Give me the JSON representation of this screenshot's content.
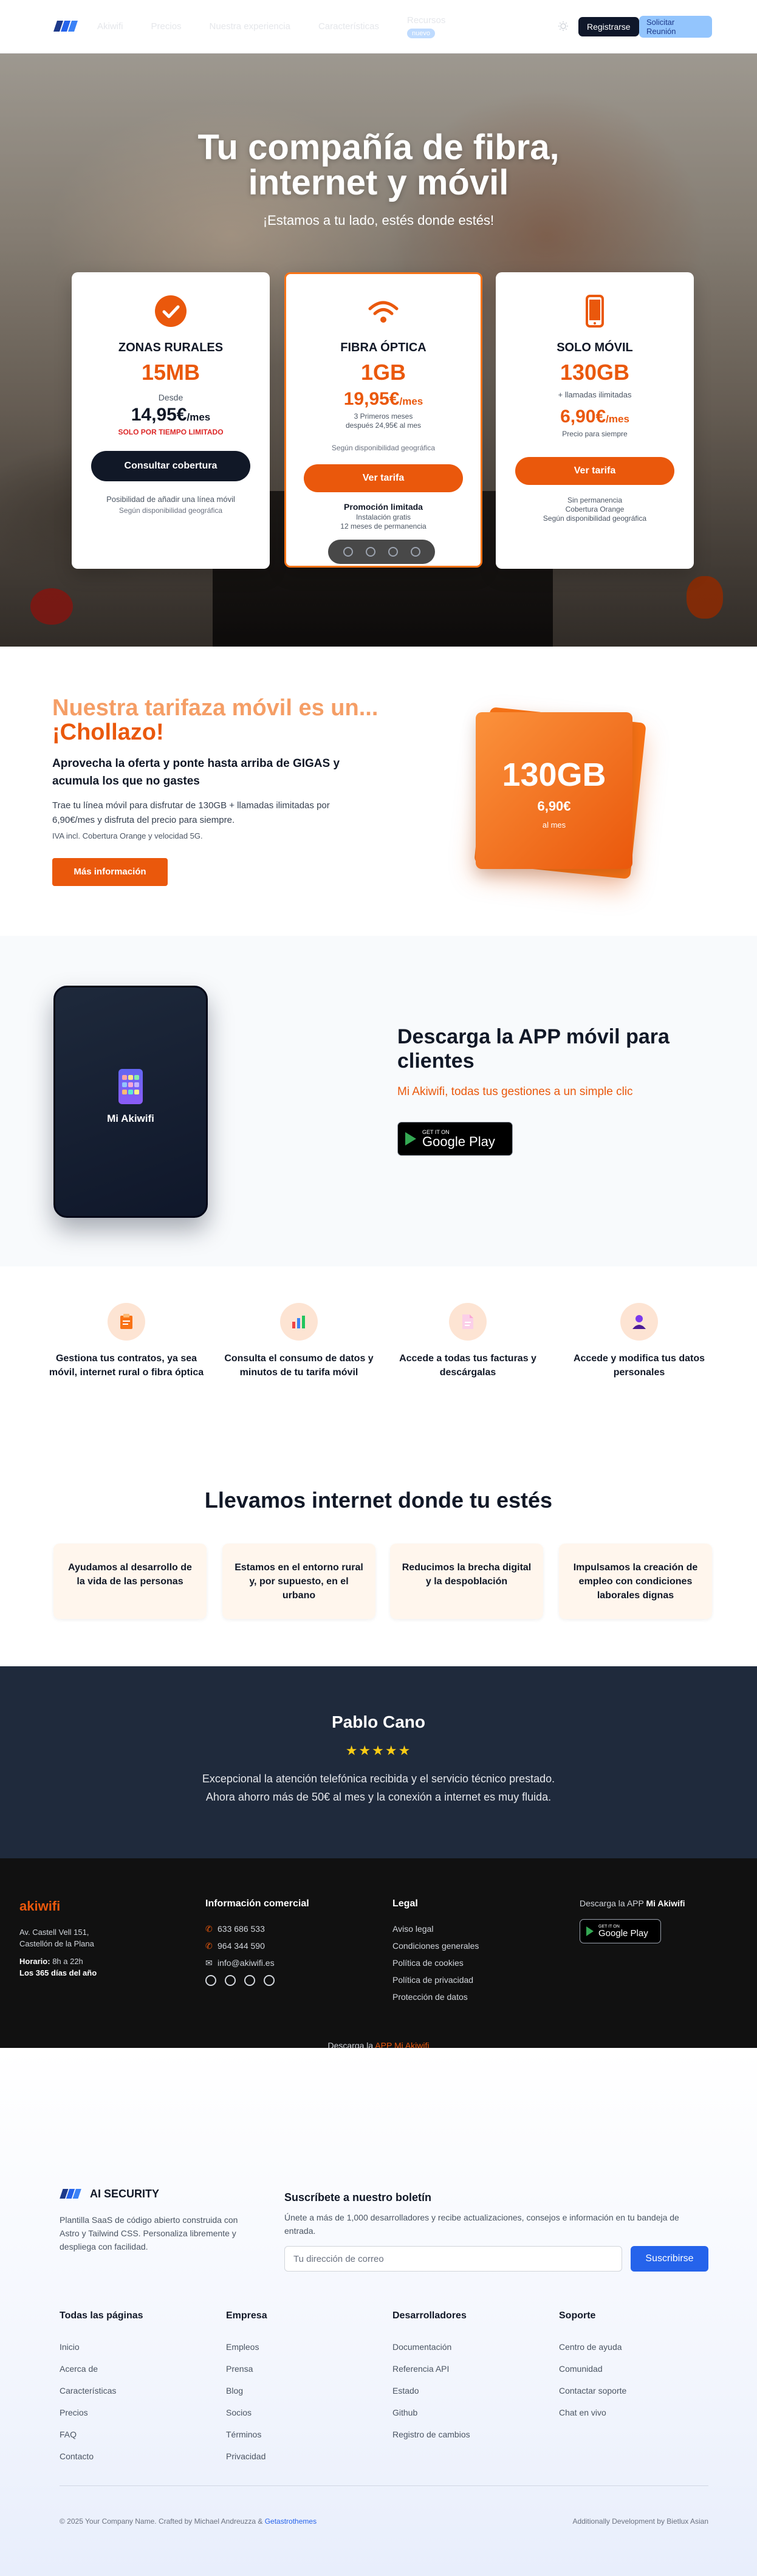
{
  "nav": {
    "links": [
      "Akiwifi",
      "Precios",
      "Nuestra experiencia",
      "Características",
      "Recursos"
    ],
    "new_badge": "nuevo",
    "register": "Registrarse",
    "meeting": "Solicitar Reunión"
  },
  "hero": {
    "title_l1": "Tu compañía de fibra,",
    "title_l2": "internet y móvil",
    "subtitle": "¡Estamos a tu lado, estés donde estés!"
  },
  "plans": [
    {
      "name": "ZONAS RURALES",
      "data": "15MB",
      "line1": "Desde",
      "price": "14,95€",
      "price_unit": "/mes",
      "flag": "SOLO POR TIEMPO LIMITADO",
      "button": "Consultar cobertura",
      "note": "Posibilidad de añadir una línea móvil",
      "note2": "Según disponibilidad geográfica"
    },
    {
      "name": "FIBRA ÓPTICA",
      "data": "1GB",
      "price": "19,95€",
      "price_unit": "/mes",
      "small1": "3 Primeros meses",
      "small2": "después 24,95€ al mes",
      "note2": "Según disponibilidad geográfica",
      "button": "Ver tarifa",
      "promo": "Promoción limitada",
      "promo1": "Instalación gratis",
      "promo2": "12 meses de permanencia"
    },
    {
      "name": "SOLO MÓVIL",
      "data": "130GB",
      "line1": "+ llamadas ilimitadas",
      "price": "6,90€",
      "price_unit": "/mes",
      "small1": "Precio para siempre",
      "button": "Ver tarifa",
      "note1": "Sin permanencia",
      "note2": "Cobertura Orange",
      "note3": "Según disponibilidad geográfica"
    }
  ],
  "promo": {
    "t1": "Nuestra tarifaza móvil es un...",
    "t2": "¡Chollazo!",
    "lead": "Aprovecha la oferta y ponte hasta arriba de GIGAS y acumula los que no gastes",
    "desc": "Trae tu línea móvil para disfrutar de 130GB + llamadas ilimitadas por 6,90€/mes y disfruta del precio para siempre.",
    "iva": "IVA incl. Cobertura Orange y velocidad 5G.",
    "button": "Más información",
    "box_gb": "130GB",
    "box_price": "6,90€",
    "box_unit": "al mes"
  },
  "app": {
    "phone_label": "Mi Akiwifi",
    "title": "Descarga la APP móvil para clientes",
    "subtitle": "Mi Akiwifi, todas tus gestiones a un simple clic",
    "gplay_top": "GET IT ON",
    "gplay_main": "Google Play"
  },
  "features": [
    "Gestiona tus contratos, ya sea móvil, internet rural o fibra óptica",
    "Consulta el consumo de datos y minutos de tu tarifa móvil",
    "Accede a todas tus facturas y descárgalas",
    "Accede y modifica tus datos personales"
  ],
  "coverage": {
    "title": "Llevamos internet donde tu estés",
    "items": [
      "Ayudamos al desarrollo de la vida de las personas",
      "Estamos en el entorno rural y, por supuesto, en el urbano",
      "Reducimos la brecha digital y la despoblación",
      "Impulsamos la creación de empleo con condiciones laborales dignas"
    ]
  },
  "testimonial": {
    "name": "Pablo Cano",
    "stars": "★★★★★",
    "quote": "Excepcional la atención telefónica recibida y el servicio técnico prestado. Ahora ahorro más de 50€ al mes y la conexión a internet es muy fluida."
  },
  "dark_footer": {
    "brand": "akiwifi",
    "addr1": "Av. Castell Vell 151,",
    "addr2": "Castellón de la Plana",
    "hours_label": "Horario:",
    "hours": "8h a 22h",
    "days": "Los 365 días del año",
    "info_title": "Información comercial",
    "phone1": "633 686 533",
    "phone2": "964 344 590",
    "email": "info@akiwifi.es",
    "legal_title": "Legal",
    "legal": [
      "Aviso legal",
      "Condiciones generales",
      "Política de cookies",
      "Política de privacidad",
      "Protección de datos"
    ],
    "download_prefix": "Descarga la APP",
    "download_app": "Mi Akiwifi",
    "bottom_prefix": "Descarga la",
    "bottom_app": "APP Mi Akiwifi"
  },
  "light_footer": {
    "brand": "AI SECURITY",
    "pitch": "Plantilla SaaS de código abierto construida con Astro y Tailwind CSS. Personaliza libremente y despliega con facilidad.",
    "newsletter_title": "Suscríbete a nuestro boletín",
    "newsletter_desc": "Únete a más de 1,000 desarrolladores y recibe actualizaciones, consejos e información en tu bandeja de entrada.",
    "email_placeholder": "Tu dirección de correo",
    "subscribe": "Suscribirse",
    "columns": [
      {
        "title": "Todas las páginas",
        "links": [
          "Inicio",
          "Acerca de",
          "Características",
          "Precios",
          "FAQ",
          "Contacto"
        ]
      },
      {
        "title": "Empresa",
        "links": [
          "Empleos",
          "Prensa",
          "Blog",
          "Socios",
          "Términos",
          "Privacidad"
        ]
      },
      {
        "title": "Desarrolladores",
        "links": [
          "Documentación",
          "Referencia API",
          "Estado",
          "Github",
          "Registro de cambios"
        ]
      },
      {
        "title": "Soporte",
        "links": [
          "Centro de ayuda",
          "Comunidad",
          "Contactar soporte",
          "Chat en vivo"
        ]
      }
    ],
    "copyright": "© 2025 Your Company Name. Crafted by Michael Andreuzza &",
    "copyright_link": "Getastrothemes",
    "additional": "Additionally Development by Bietlux Asian"
  },
  "colors": {
    "accent": "#ea580c",
    "dark": "#111827",
    "blue": "#2563eb",
    "testimonial_bg": "#1f2a3c",
    "footer_bg": "#111111"
  }
}
